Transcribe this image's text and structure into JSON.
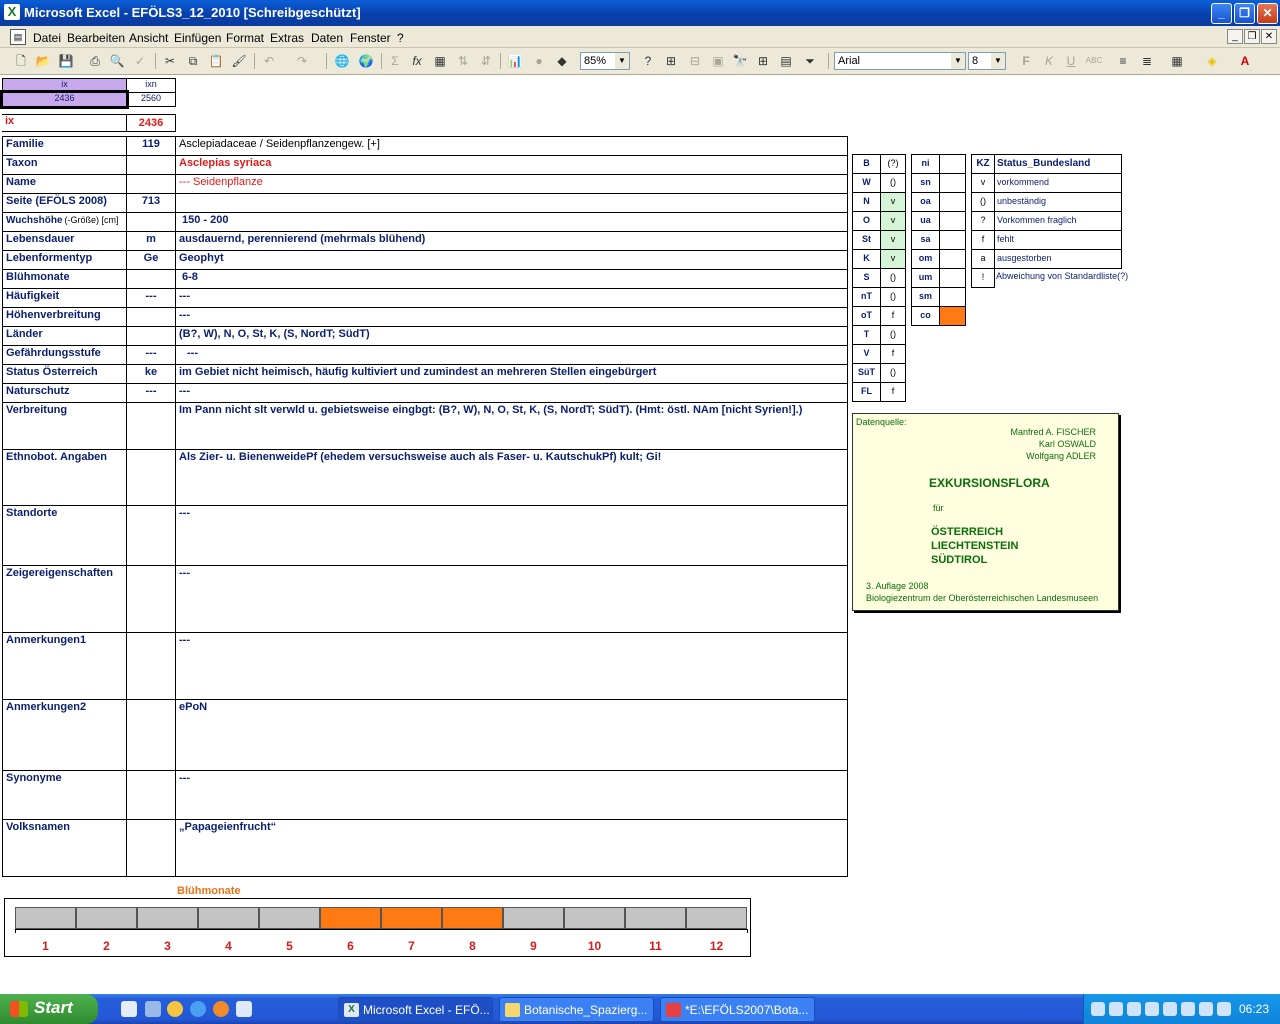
{
  "window": {
    "title": "Microsoft Excel - EFÖLS3_12_2010  [Schreibgeschützt]",
    "min": "_",
    "max": "❐",
    "close": "✕"
  },
  "menu": [
    "Datei",
    "Bearbeiten",
    "Ansicht",
    "Einfügen",
    "Format",
    "Extras",
    "Daten",
    "Fenster",
    "?"
  ],
  "toolbar": {
    "zoom": "85%",
    "font": "Arial",
    "size": "8"
  },
  "sheet": {
    "ix_header": "ix",
    "ixn_header": "ixn",
    "ix_value": "2436",
    "ixn_value": "2560",
    "ix_label": "ix",
    "ix_red": "2436",
    "rows": [
      {
        "label": "Familie",
        "code": "119",
        "value": "Asclepiadaceae  /  Seidenpflanzengew. [+]"
      },
      {
        "label": "Taxon",
        "code": "",
        "value": "Asclepias syriaca"
      },
      {
        "label": "Name",
        "code": "",
        "value": "--- Seidenpflanze"
      },
      {
        "label": "Seite (EFÖLS 2008)",
        "code": "713",
        "value": ""
      },
      {
        "label": "Wuchshöhe",
        "label_suffix": "(-Größe) [cm]",
        "code": "",
        "value": "150 - 200"
      },
      {
        "label": "Lebensdauer",
        "code": "m",
        "value": "ausdauernd, perennierend (mehrmals blühend)"
      },
      {
        "label": "Lebenformentyp",
        "code": "Ge",
        "value": "Geophyt"
      },
      {
        "label": "Blühmonate",
        "code": "",
        "value": "6-8"
      },
      {
        "label": "Häufigkeit",
        "code": "---",
        "value": "---"
      },
      {
        "label": "Höhenverbreitung",
        "code": "",
        "value": "---"
      },
      {
        "label": "Länder",
        "code": "",
        "value": "(B?, W), N, O, St, K, (S, NordT; SüdT)"
      },
      {
        "label": "Gefährdungsstufe",
        "code": "---",
        "value": "---"
      },
      {
        "label": "Status Österreich",
        "code": "ke",
        "value": "im Gebiet nicht heimisch, häufig kultiviert und zumindest an mehreren Stellen eingebürgert"
      },
      {
        "label": "Naturschutz",
        "code": "---",
        "value": "---"
      },
      {
        "label": "Verbreitung",
        "code": "",
        "value": "Im Pann nicht slt verwld u. gebietsweise eingbgt: (B?, W), N, O, St, K, (S, NordT; SüdT). (Hmt: östl. NAm [nicht Syrien!].)"
      },
      {
        "label": "Ethnobot. Angaben",
        "code": "",
        "value": "Als Zier- u. BienenweidePf (ehedem versuchsweise auch als Faser- u. KautschukPf) kult; Gi!"
      },
      {
        "label": "Standorte",
        "code": "",
        "value": "---"
      },
      {
        "label": "Zeigereigenschaften",
        "code": "",
        "value": "---"
      },
      {
        "label": "Anmerkungen1",
        "code": "",
        "value": "---"
      },
      {
        "label": "Anmerkungen2",
        "code": "",
        "value": "ePoN"
      },
      {
        "label": "Synonyme",
        "code": "",
        "value": "---"
      },
      {
        "label": "Volksnamen",
        "code": "",
        "value": "„Papageienfrucht“"
      }
    ],
    "states": [
      {
        "k": "B",
        "v": "(?)"
      },
      {
        "k": "W",
        "v": "()"
      },
      {
        "k": "N",
        "v": "v"
      },
      {
        "k": "O",
        "v": "v"
      },
      {
        "k": "St",
        "v": "v"
      },
      {
        "k": "K",
        "v": "v"
      },
      {
        "k": "S",
        "v": "()"
      },
      {
        "k": "nT",
        "v": "()"
      },
      {
        "k": "oT",
        "v": "f"
      },
      {
        "k": "T",
        "v": "()"
      },
      {
        "k": "V",
        "v": "f"
      },
      {
        "k": "SüT",
        "v": "()"
      },
      {
        "k": "FL",
        "v": "f"
      }
    ],
    "regions": [
      "ni",
      "sn",
      "oa",
      "ua",
      "sa",
      "om",
      "um",
      "sm",
      "co"
    ],
    "legend_header_k": "KZ",
    "legend_header_v": "Status_Bundesland",
    "legend": [
      {
        "k": "v",
        "v": "vorkommend"
      },
      {
        "k": "()",
        "v": "unbeständig"
      },
      {
        "k": "?",
        "v": "Vorkommen fraglich"
      },
      {
        "k": "f",
        "v": "fehlt"
      },
      {
        "k": "a",
        "v": "ausgestorben"
      },
      {
        "k": "!",
        "v": "Abweichung von Standardliste(?)"
      }
    ],
    "source": {
      "label": "Datenquelle:",
      "author1": "Manfred A. FISCHER",
      "author2": "Karl OSWALD",
      "author3": "Wolfgang ADLER",
      "title": "EXKURSIONSFLORA",
      "fuer": "für",
      "c1": "ÖSTERREICH",
      "c2": "LIECHTENSTEIN",
      "c3": "SÜDTIROL",
      "edition": "3. Auflage 2008",
      "publisher": "Biologiezentrum der Oberösterreichischen Landesmuseen"
    },
    "chart_title": "Blühmonate",
    "months": [
      "1",
      "2",
      "3",
      "4",
      "5",
      "6",
      "7",
      "8",
      "9",
      "10",
      "11",
      "12"
    ],
    "bloom_months": [
      6,
      7,
      8
    ]
  },
  "taskbar": {
    "start": "Start",
    "tasks": [
      "Microsoft Excel - EFÖ...",
      "Botanische_Spazierg...",
      "*E:\\EFÖLS2007\\Bota..."
    ],
    "clock": "06:23"
  },
  "colors": {
    "accent_orange": "#ff7a12",
    "state_green": "#d6f5d6",
    "lavender": "#c8a8ec",
    "source_bg": "#ffffe0",
    "header_blue": "#0b1f6e"
  }
}
